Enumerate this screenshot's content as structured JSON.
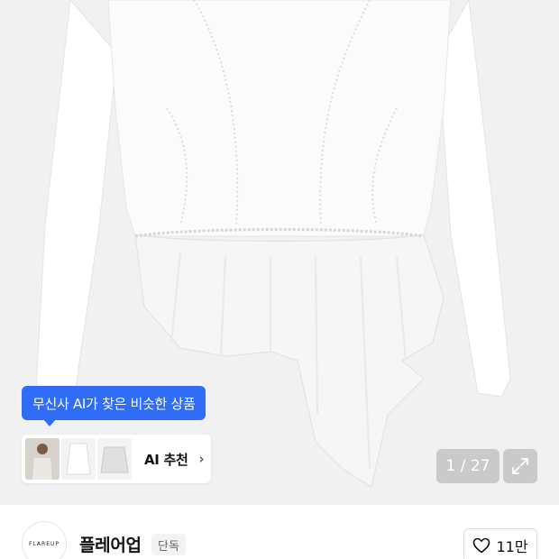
{
  "ai_tooltip": {
    "text": "무신사 AI가 찾은 비슷한 상품"
  },
  "ai_card": {
    "label": "AI 추천",
    "chevron": "›",
    "thumbnail_icons": [
      "model-photo-thumb",
      "white-top-thumb",
      "gray-top-thumb"
    ]
  },
  "pager": {
    "text": "1 / 27",
    "expand_icon": "expand-icon"
  },
  "brand": {
    "logo_text": "FLAREUP",
    "name": "플레어업",
    "badge": "단독",
    "like_count": "11만",
    "like_icon": "heart-outline-icon"
  },
  "colors": {
    "accent": "#2f6df6",
    "image_background": "#f1f1f1",
    "badge_background": "#f2f3f5"
  }
}
